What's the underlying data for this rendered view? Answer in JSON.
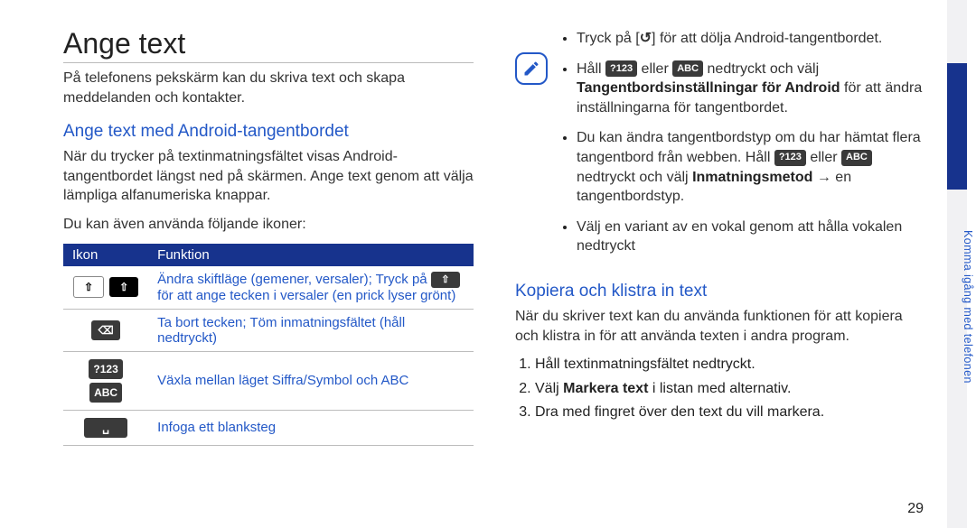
{
  "page": {
    "number": "29",
    "side_label": "Komma igång med telefonen"
  },
  "left": {
    "title": "Ange text",
    "intro": "På telefonens pekskärm kan du skriva text och skapa meddelanden och kontakter.",
    "h2": "Ange text med Android-tangentbordet",
    "p1": "När du trycker på textinmatningsfältet visas Android-tangentbordet längst ned på skärmen. Ange text genom att välja lämpliga alfanumeriska knappar.",
    "p2": "Du kan även använda följande ikoner:",
    "table": {
      "headers": [
        "Ikon",
        "Funktion"
      ],
      "rows": [
        {
          "icons": [
            "shift-outline",
            "shift-solid"
          ],
          "text_pre": "Ändra skiftläge (gemener, versaler); Tryck på ",
          "inline_icon": "shift-solid",
          "text_post": " för att ange tecken i versaler (en prick lyser grönt)"
        },
        {
          "icons": [
            "backspace"
          ],
          "text": "Ta bort tecken; Töm inmatningsfältet (håll nedtryckt)"
        },
        {
          "icons": [
            "?123",
            "ABC"
          ],
          "text": "Växla mellan läget Siffra/Symbol och ABC"
        },
        {
          "icons": [
            "space"
          ],
          "text": "Infoga ett blanksteg"
        }
      ]
    }
  },
  "right": {
    "note": {
      "bullets": [
        {
          "pre": "Tryck på [",
          "glyph": "↺",
          "post": "] för att dölja Android-tangentbordet."
        },
        {
          "pre": "Håll ",
          "icon1": "?123",
          "mid1": " eller ",
          "icon2": "ABC",
          "mid2": " nedtryckt och välj ",
          "bold": "Tangentbordsinställningar för Android",
          "post": " för att ändra inställningarna för tangentbordet."
        },
        {
          "pre": "Du kan ändra tangentbordstyp om du har hämtat flera tangentbord från webben. Håll ",
          "icon1": "?123",
          "mid1": " eller ",
          "icon2": "ABC",
          "mid2": " nedtryckt och välj ",
          "bold": "Inmatningsmetod",
          "post": " → en tangentbordstyp."
        },
        {
          "text": "Välj en variant av en vokal genom att hålla vokalen nedtryckt"
        }
      ]
    },
    "h2": "Kopiera och klistra in text",
    "p1": "När du skriver text kan du använda funktionen för att kopiera och klistra in för att använda texten i andra program.",
    "steps": [
      "Håll textinmatningsfältet nedtryckt.",
      {
        "pre": "Välj ",
        "bold": "Markera text",
        "post": " i listan med alternativ."
      },
      "Dra med fingret över den text du vill markera."
    ]
  }
}
